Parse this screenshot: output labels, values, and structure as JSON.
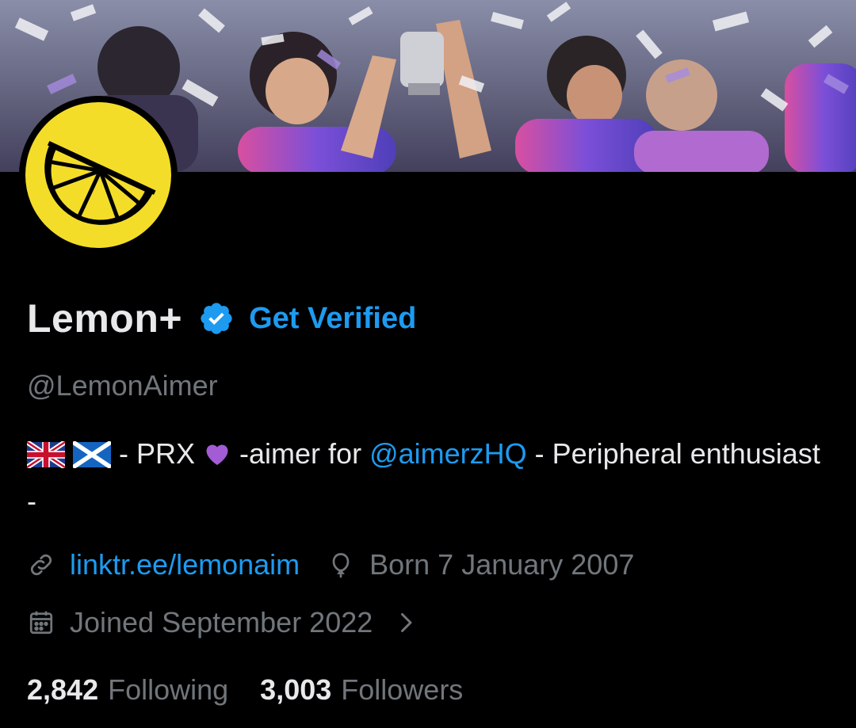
{
  "profile": {
    "display_name": "Lemon+",
    "get_verified_label": "Get Verified",
    "handle": "@LemonAimer"
  },
  "bio": {
    "part1": " - PRX ",
    "part2": " -aimer for ",
    "mention": "@aimerzHQ",
    "part3": "  - Peripheral enthusiast -"
  },
  "meta": {
    "link_text": "linktr.ee/lemonaim",
    "birthday": "Born 7 January 2007",
    "joined": "Joined September 2022"
  },
  "stats": {
    "following_count": "2,842",
    "following_label": "Following",
    "followers_count": "3,003",
    "followers_label": "Followers"
  },
  "colors": {
    "accent": "#1d9bf0",
    "muted": "#71767b",
    "text": "#e7e9ea",
    "avatar_yellow": "#f4dd29"
  },
  "icons": {
    "verified": "verified-badge-icon",
    "link": "link-icon",
    "birthday": "balloon-icon",
    "calendar": "calendar-icon",
    "chevron": "chevron-right-icon"
  }
}
